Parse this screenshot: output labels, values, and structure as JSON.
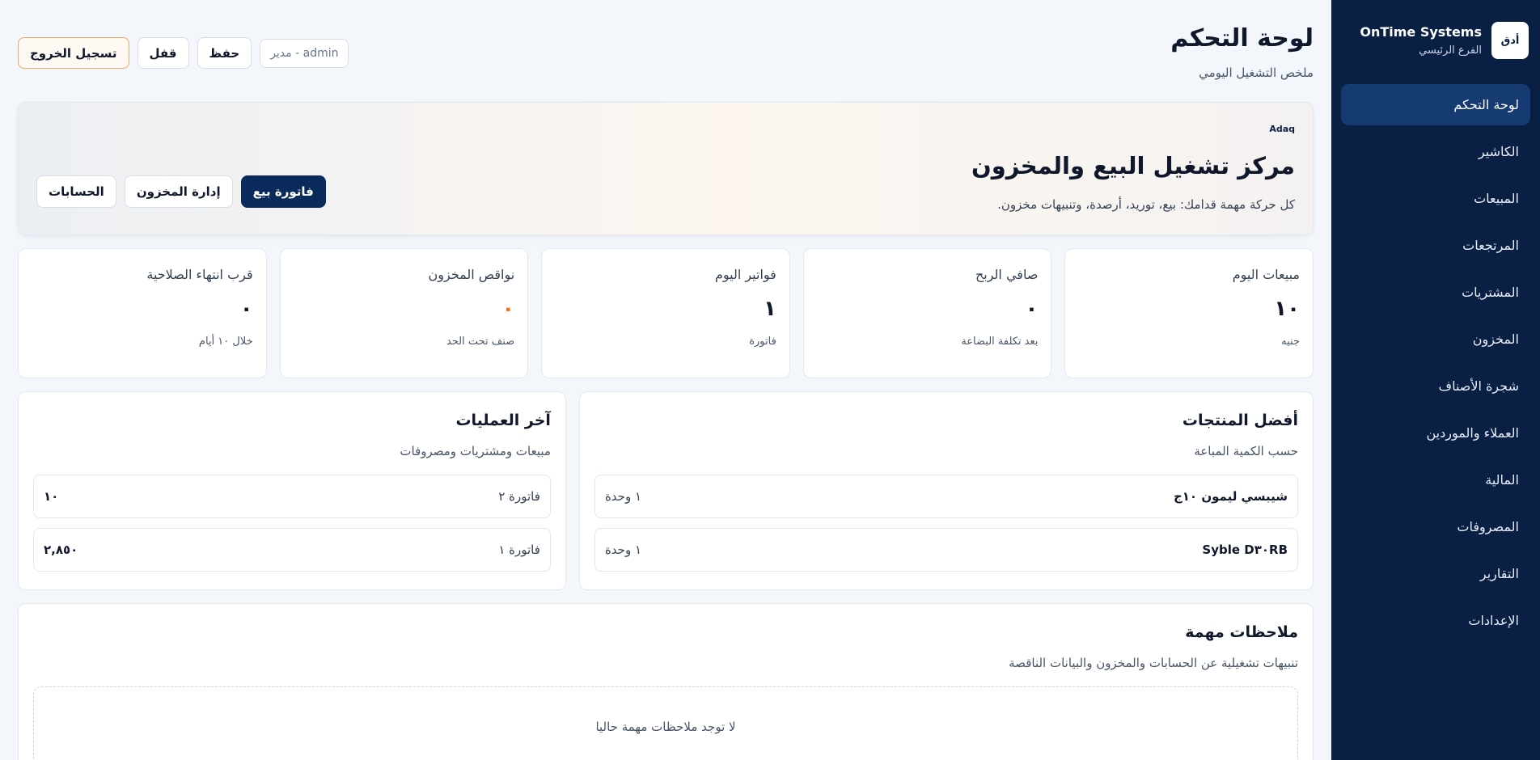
{
  "brand": {
    "name": "OnTime Systems",
    "branch": "الفرع الرئيسي",
    "logo_text": "أدق"
  },
  "sidebar": {
    "items": [
      {
        "label": "لوحة التحكم",
        "active": true
      },
      {
        "label": "الكاشير"
      },
      {
        "label": "المبيعات"
      },
      {
        "label": "المرتجعات"
      },
      {
        "label": "المشتريات"
      },
      {
        "label": "المخزون"
      },
      {
        "label": "شجرة الأصناف"
      },
      {
        "label": "العملاء والموردين"
      },
      {
        "label": "المالية"
      },
      {
        "label": "المصروفات"
      },
      {
        "label": "التقارير"
      },
      {
        "label": "الإعدادات"
      }
    ]
  },
  "header": {
    "title": "لوحة التحكم",
    "subtitle": "ملخص التشغيل اليومي",
    "user": "admin - مدير",
    "save_label": "حفظ",
    "lock_label": "قفل",
    "logout_label": "تسجيل الخروج"
  },
  "hero": {
    "tag": "Adaq",
    "title": "مركز تشغيل البيع والمخزون",
    "description": "كل حركة مهمة قدامك: بيع، توريد، أرصدة، وتنبيهات مخزون.",
    "actions": {
      "sale_invoice": "فاتورة بيع",
      "inventory": "إدارة المخزون",
      "accounts": "الحسابات"
    }
  },
  "stats": [
    {
      "label": "مبيعات اليوم",
      "value": "١٠",
      "note": "جنيه",
      "warn": false
    },
    {
      "label": "صافي الربح",
      "value": "٠",
      "note": "بعد تكلفة البضاعة",
      "warn": false
    },
    {
      "label": "فواتير اليوم",
      "value": "١",
      "note": "فاتورة",
      "warn": false
    },
    {
      "label": "نواقص المخزون",
      "value": "٠",
      "note": "صنف تحت الحد",
      "warn": true
    },
    {
      "label": "قرب انتهاء الصلاحية",
      "value": "٠",
      "note": "خلال ١٠ أيام",
      "warn": false
    }
  ],
  "top_products": {
    "title": "أفضل المنتجات",
    "subtitle": "حسب الكمية المباعة",
    "rows": [
      {
        "name": "شيبسي ليمون ١٠ج",
        "qty": "١ وحدة"
      },
      {
        "name": "Syble D٣٠RB",
        "qty": "١ وحدة"
      }
    ]
  },
  "recent_ops": {
    "title": "آخر العمليات",
    "subtitle": "مبيعات ومشتريات ومصروفات",
    "rows": [
      {
        "name": "فاتورة ٢",
        "amount": "١٠"
      },
      {
        "name": "فاتورة ١",
        "amount": "٢,٨٥٠"
      }
    ]
  },
  "notes": {
    "title": "ملاحظات مهمة",
    "subtitle": "تنبيهات تشغيلية عن الحسابات والمخزون والبيانات الناقصة",
    "empty": "لا توجد ملاحظات مهمة حاليا"
  },
  "colors": {
    "sidebar_bg": "#0a1f44",
    "primary": "#0a2a5c",
    "warning": "#f97316",
    "logout_border": "#f1a66a"
  }
}
